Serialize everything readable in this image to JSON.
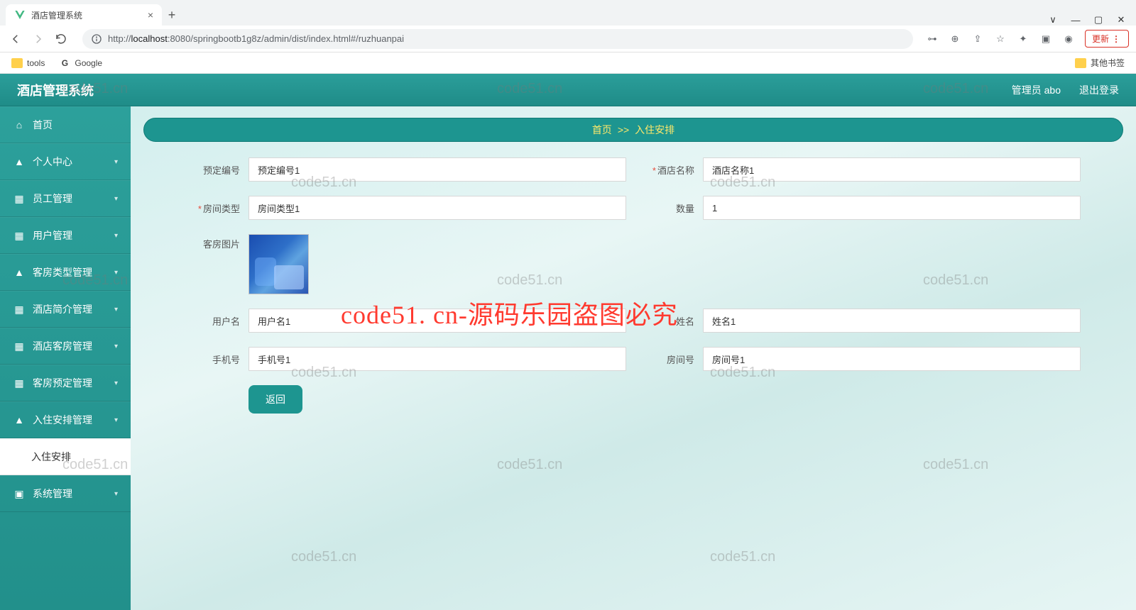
{
  "browser": {
    "tab_title": "酒店管理系统",
    "url_host": "localhost",
    "url_port": ":8080",
    "url_path": "/springbootb1g8z/admin/dist/index.html#/ruzhuanpai",
    "url_prefix": "http://",
    "update_label": "更新",
    "bookmarks": {
      "tools": "tools",
      "google": "Google",
      "other": "其他书签"
    }
  },
  "header": {
    "brand": "酒店管理系统",
    "admin_label": "管理员 abo",
    "logout_label": "退出登录"
  },
  "sidebar": {
    "items": [
      {
        "label": "首页"
      },
      {
        "label": "个人中心"
      },
      {
        "label": "员工管理"
      },
      {
        "label": "用户管理"
      },
      {
        "label": "客房类型管理"
      },
      {
        "label": "酒店简介管理"
      },
      {
        "label": "酒店客房管理"
      },
      {
        "label": "客房预定管理"
      },
      {
        "label": "入住安排管理"
      },
      {
        "label": "系统管理"
      }
    ],
    "sub_label": "入住安排"
  },
  "breadcrumb": {
    "home": "首页",
    "sep": ">>",
    "current": "入住安排"
  },
  "form": {
    "booking_no": {
      "label": "预定编号",
      "value": "预定编号1"
    },
    "hotel_name": {
      "label": "酒店名称",
      "value": "酒店名称1"
    },
    "room_type": {
      "label": "房间类型",
      "value": "房间类型1"
    },
    "qty": {
      "label": "数量",
      "value": "1"
    },
    "room_img": {
      "label": "客房图片"
    },
    "username": {
      "label": "用户名",
      "value": "用户名1"
    },
    "name": {
      "label": "姓名",
      "value": "姓名1"
    },
    "phone": {
      "label": "手机号",
      "value": "手机号1"
    },
    "room_no": {
      "label": "房间号",
      "value": "房间号1"
    },
    "back_btn": "返回"
  },
  "watermark": {
    "small": "code51.cn",
    "big": "code51. cn-源码乐园盗图必究"
  }
}
